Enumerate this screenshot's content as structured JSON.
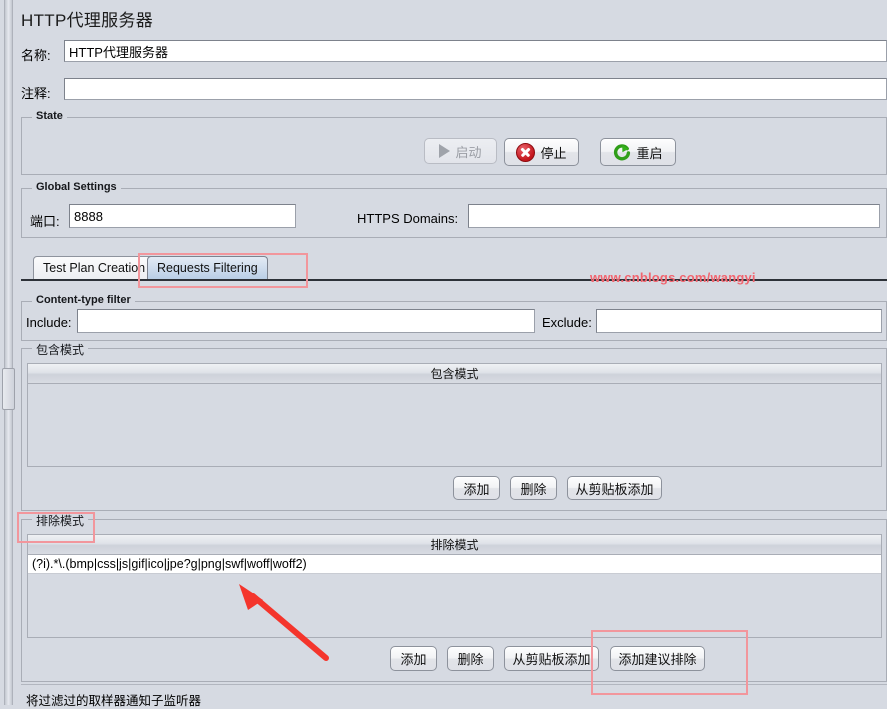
{
  "window": {
    "title": "HTTP代理服务器"
  },
  "fields": {
    "name_label": "名称:",
    "name_value": "HTTP代理服务器",
    "comment_label": "注释:",
    "comment_value": ""
  },
  "state": {
    "caption": "State",
    "start_button": "启动",
    "stop_button": "停止",
    "restart_button": "重启",
    "start_icon": "play-icon",
    "stop_icon": "stop-sign-icon",
    "restart_icon": "refresh-icon"
  },
  "global_settings": {
    "caption": "Global Settings",
    "port_label": "端口:",
    "port_value": "8888",
    "https_domains_label": "HTTPS Domains:",
    "https_domains_value": ""
  },
  "tabs": [
    {
      "label": "Test Plan Creation",
      "active": false
    },
    {
      "label": "Requests Filtering",
      "active": true
    }
  ],
  "content_type_filter": {
    "caption": "Content-type filter",
    "include_label": "Include:",
    "include_value": "",
    "exclude_label": "Exclude:",
    "exclude_value": ""
  },
  "include_patterns": {
    "caption": "包含模式",
    "column_header": "包含模式",
    "rows": [],
    "buttons": [
      {
        "label": "添加"
      },
      {
        "label": "删除"
      },
      {
        "label": "从剪贴板添加"
      }
    ]
  },
  "exclude_patterns": {
    "caption": "排除模式",
    "column_header": "排除模式",
    "rows": [
      "(?i).*\\.(bmp|css|js|gif|ico|jpe?g|png|swf|woff|woff2)"
    ],
    "buttons": [
      {
        "label": "添加"
      },
      {
        "label": "删除"
      },
      {
        "label": "从剪贴板添加"
      },
      {
        "label": "添加建议排除"
      }
    ]
  },
  "footer": {
    "notify_label": "将过滤过的取样器通知子监听器"
  },
  "annotations": {
    "watermark": "www.cnblogs.com/wangyi",
    "highlight_color": "#f2969c",
    "arrow_color": "#f4352c"
  }
}
